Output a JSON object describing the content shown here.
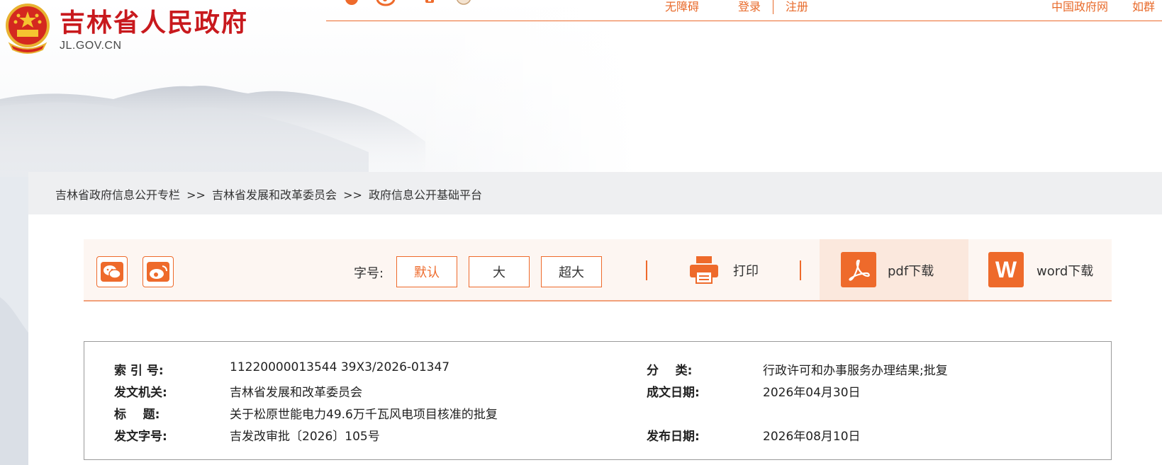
{
  "header": {
    "site_title": "吉林省人民政府",
    "site_domain": "JL.GOV.CN",
    "top_links": {
      "accessibility": "无障碍",
      "login": "登录",
      "register": "注册",
      "central_gov": "中国政府网",
      "partial_right": "如群"
    }
  },
  "breadcrumb": {
    "items": [
      "吉林省政府信息公开专栏",
      "吉林省发展和改革委员会",
      "政府信息公开基础平台"
    ],
    "separator": ">>"
  },
  "toolbar": {
    "font_size_label": "字号:",
    "font_sizes": [
      "默认",
      "大",
      "超大"
    ],
    "active_font_size": "默认",
    "print_label": "打印",
    "pdf_label": "pdf下载",
    "word_label": "word下载",
    "word_icon_letter": "W",
    "accent_color": "#ee6a2b"
  },
  "metadata": {
    "index_no_label": "索 引 号:",
    "index_no": "11220000013544 39X3/2026-01347",
    "category_label": "分    类:",
    "category": "行政许可和办事服务办理结果;批复",
    "issuer_label": "发文机关:",
    "issuer": "吉林省发展和改革委员会",
    "written_date_label": "成文日期:",
    "written_date": "2026年04月30日",
    "title_label": "标    题:",
    "title": "关于松原世能电力49.6万千瓦风电项目核准的批复",
    "doc_no_label": "发文字号:",
    "doc_no": "吉发改审批〔2026〕105号",
    "publish_date_label": "发布日期:",
    "publish_date": "2026年08月10日"
  }
}
